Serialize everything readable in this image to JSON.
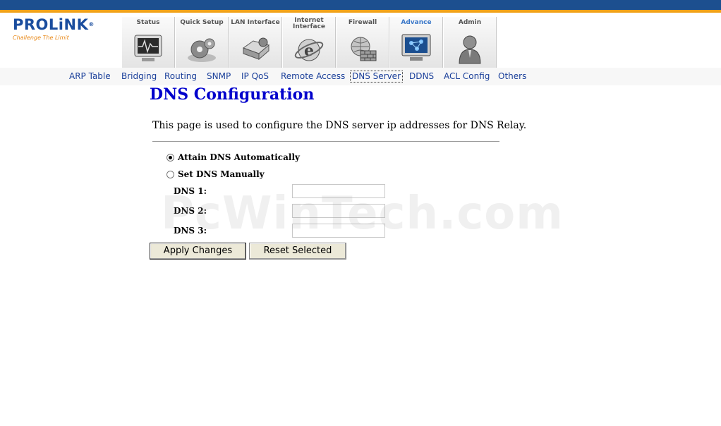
{
  "brand": {
    "name": "PROLiNK",
    "registered": "®",
    "slogan": "Challenge The Limit"
  },
  "tabs": [
    {
      "label": "Status",
      "icon": "monitor-pulse-icon"
    },
    {
      "label": "Quick Setup",
      "icon": "gears-icon"
    },
    {
      "label": "LAN Interface",
      "icon": "drive-icon"
    },
    {
      "label": "Internet\nInterface",
      "icon": "internet-explorer-icon"
    },
    {
      "label": "Firewall",
      "icon": "firewall-globe-icon"
    },
    {
      "label": "Advance",
      "icon": "network-monitor-icon",
      "active": true
    },
    {
      "label": "Admin",
      "icon": "admin-user-icon"
    }
  ],
  "subnav": [
    "ARP Table",
    "Bridging",
    "Routing",
    "SNMP",
    "IP QoS",
    "Remote Access",
    "DNS Server",
    "DDNS",
    "ACL Config",
    "Others"
  ],
  "page": {
    "title": "DNS Configuration",
    "description": "This page is used to configure the DNS server ip addresses for DNS Relay."
  },
  "form": {
    "auto_label": "Attain DNS Automatically",
    "manual_label": "Set DNS Manually",
    "selected_mode": "auto",
    "dns1_label": "DNS 1:",
    "dns2_label": "DNS 2:",
    "dns3_label": "DNS 3:",
    "dns1_value": "",
    "dns2_value": "",
    "dns3_value": ""
  },
  "buttons": {
    "apply": "Apply Changes",
    "reset": "Reset Selected"
  },
  "watermark": "PcWinTech.com",
  "colors": {
    "topbar": "#1c4f8f",
    "accent": "#f0a21a",
    "title": "#0000cc",
    "link": "#1a3f9a"
  }
}
